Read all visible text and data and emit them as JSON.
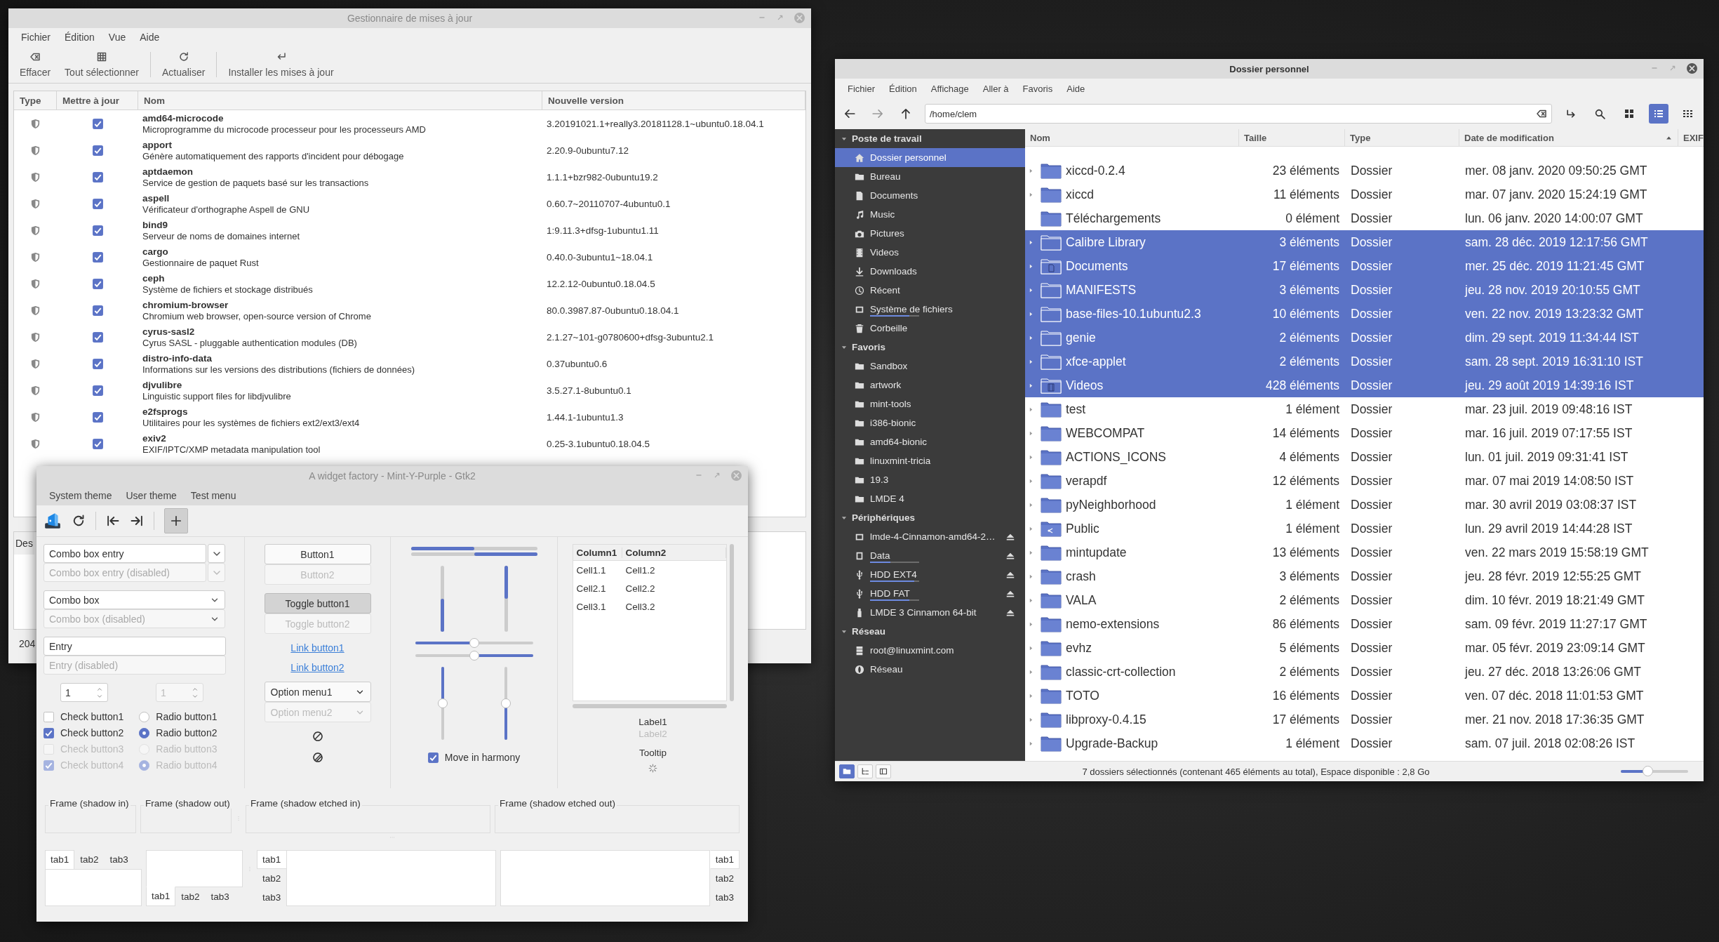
{
  "update_manager": {
    "title": "Gestionnaire de mises à jour",
    "menu": [
      "Fichier",
      "Édition",
      "Vue",
      "Aide"
    ],
    "toolbar": [
      [
        {
          "label": "Effacer",
          "kind": "clear"
        },
        {
          "label": "Tout sélectionner",
          "kind": "select"
        }
      ],
      [
        {
          "label": "Actualiser",
          "kind": "refresh"
        }
      ],
      [
        {
          "label": "Installer les mises à jour",
          "kind": "install"
        }
      ]
    ],
    "columns": [
      "Type",
      "Mettre à jour",
      "Nom",
      "Nouvelle version"
    ],
    "rows": [
      {
        "name": "amd64-microcode",
        "description": "Microprogramme du microcode processeur pour les processeurs AMD",
        "version": "3.20191021.1+really3.20181128.1~ubuntu0.18.04.1",
        "checked": true
      },
      {
        "name": "apport",
        "description": "Génère automatiquement des rapports d'incident pour débogage",
        "version": "2.20.9-0ubuntu7.12",
        "checked": true
      },
      {
        "name": "aptdaemon",
        "description": "Service de gestion de paquets basé sur les transactions",
        "version": "1.1.1+bzr982-0ubuntu19.2",
        "checked": true
      },
      {
        "name": "aspell",
        "description": "Vérificateur d'orthographe Aspell de GNU",
        "version": "0.60.7~20110707-4ubuntu0.1",
        "checked": true
      },
      {
        "name": "bind9",
        "description": "Serveur de noms de domaines internet",
        "version": "1:9.11.3+dfsg-1ubuntu1.11",
        "checked": true
      },
      {
        "name": "cargo",
        "description": "Gestionnaire de paquet Rust",
        "version": "0.40.0-3ubuntu1~18.04.1",
        "checked": true
      },
      {
        "name": "ceph",
        "description": "Système de fichiers et stockage distribués",
        "version": "12.2.12-0ubuntu0.18.04.5",
        "checked": true
      },
      {
        "name": "chromium-browser",
        "description": "Chromium web browser, open-source version of Chrome",
        "version": "80.0.3987.87-0ubuntu0.18.04.1",
        "checked": true
      },
      {
        "name": "cyrus-sasl2",
        "description": "Cyrus SASL - pluggable authentication modules (DB)",
        "version": "2.1.27~101-g0780600+dfsg-3ubuntu2.1",
        "checked": true
      },
      {
        "name": "distro-info-data",
        "description": "Informations sur les versions des distributions (fichiers de données)",
        "version": "0.37ubuntu0.6",
        "checked": true
      },
      {
        "name": "djvulibre",
        "description": "Linguistic support files for libdjvulibre",
        "version": "3.5.27.1-8ubuntu0.1",
        "checked": true
      },
      {
        "name": "e2fsprogs",
        "description": "Utilitaires pour les systèmes de fichiers ext2/ext3/ext4",
        "version": "1.44.1-1ubuntu1.3",
        "checked": true
      },
      {
        "name": "exiv2",
        "description": "EXIF/IPTC/XMP metadata manipulation tool",
        "version": "0.25-3.1ubuntu0.18.04.5",
        "checked": true
      }
    ],
    "details_tab": "Des",
    "status": "204"
  },
  "widget_factory": {
    "title": "A widget factory - Mint-Y-Purple - Gtk2",
    "menu": [
      "System theme",
      "User theme",
      "Test menu"
    ],
    "toolbar": [
      [
        {
          "kind": "app"
        },
        {
          "kind": "refresh"
        }
      ],
      [
        {
          "kind": "first"
        },
        {
          "kind": "last"
        }
      ],
      [
        {
          "kind": "add",
          "on": true
        }
      ]
    ],
    "combo_entries": [
      {
        "value": "Combo box entry",
        "disabled": false
      },
      {
        "value": "Combo box entry (disabled)",
        "disabled": true
      }
    ],
    "combos": [
      {
        "value": "Combo box",
        "disabled": false
      },
      {
        "value": "Combo box (disabled)",
        "disabled": true
      }
    ],
    "entries": [
      {
        "value": "Entry",
        "disabled": false
      },
      {
        "value": "Entry (disabled)",
        "disabled": true
      }
    ],
    "spins": [
      {
        "value": "1",
        "disabled": false
      },
      {
        "value": "1",
        "disabled": true
      }
    ],
    "checks": [
      {
        "label": "Check button1",
        "checked": false,
        "disabled": false
      },
      {
        "label": "Check button2",
        "checked": true,
        "disabled": false
      },
      {
        "label": "Check button3",
        "checked": false,
        "disabled": true
      },
      {
        "label": "Check button4",
        "checked": true,
        "disabled": true
      }
    ],
    "radios": [
      {
        "label": "Radio button1",
        "selected": false,
        "disabled": false
      },
      {
        "label": "Radio button2",
        "selected": true,
        "disabled": false
      },
      {
        "label": "Radio button3",
        "selected": false,
        "disabled": true
      },
      {
        "label": "Radio button4",
        "selected": true,
        "disabled": true
      }
    ],
    "buttons": [
      {
        "label": "Button1",
        "disabled": false
      },
      {
        "label": "Button2",
        "disabled": true
      }
    ],
    "toggles": [
      {
        "label": "Toggle button1",
        "on": true,
        "disabled": false
      },
      {
        "label": "Toggle button2",
        "on": false,
        "disabled": true
      }
    ],
    "links": [
      "Link button1",
      "Link button2"
    ],
    "option_menus": [
      {
        "value": "Option menu1",
        "disabled": false
      },
      {
        "value": "Option menu2",
        "disabled": true
      }
    ],
    "progress_bars": [
      {
        "level": 0.5,
        "inverted": false
      },
      {
        "level": 0.5,
        "inverted": true
      }
    ],
    "vertical_progress": [
      {
        "level": 0.5,
        "inverted": false
      },
      {
        "level": 0.5,
        "inverted": true
      }
    ],
    "hscales": [
      {
        "level": 0.5,
        "inverted": false
      },
      {
        "level": 0.5,
        "inverted": true
      }
    ],
    "vscales": [
      {
        "level": 0.5,
        "inverted": false
      },
      {
        "level": 0.5,
        "inverted": true
      }
    ],
    "harmony": {
      "label": "Move in harmony",
      "checked": true
    },
    "tree": {
      "columns": [
        "Column1",
        "Column2"
      ],
      "rows": [
        [
          "Cell1.1",
          "Cell1.2"
        ],
        [
          "Cell2.1",
          "Cell2.2"
        ],
        [
          "Cell3.1",
          "Cell3.2"
        ]
      ]
    },
    "labels": [
      {
        "text": "Label1",
        "disabled": false
      },
      {
        "text": "Label2",
        "disabled": true
      }
    ],
    "tooltip": "Tooltip",
    "frames": [
      "Frame (shadow in)",
      "Frame (shadow out)",
      "Frame (shadow etched in)",
      "Frame (shadow etched out)"
    ],
    "notebooks": [
      {
        "kind": "top",
        "tabs": [
          {
            "label": "tab1",
            "selected": true
          },
          {
            "label": "tab2",
            "selected": false
          },
          {
            "label": "tab3",
            "selected": false
          }
        ]
      },
      {
        "kind": "bottom",
        "tabs": [
          {
            "label": "tab1",
            "selected": true
          },
          {
            "label": "tab2",
            "selected": false
          },
          {
            "label": "tab3",
            "selected": false
          }
        ]
      },
      {
        "kind": "left",
        "tabs": [
          {
            "label": "tab1",
            "selected": true
          },
          {
            "label": "tab2",
            "selected": false
          },
          {
            "label": "tab3",
            "selected": false
          }
        ]
      },
      {
        "kind": "right",
        "tabs": [
          {
            "label": "tab1",
            "selected": true
          },
          {
            "label": "tab2",
            "selected": false
          },
          {
            "label": "tab3",
            "selected": false
          }
        ]
      }
    ]
  },
  "file_manager": {
    "title": "Dossier personnel",
    "menu": [
      "Fichier",
      "Édition",
      "Affichage",
      "Aller à",
      "Favoris",
      "Aide"
    ],
    "path": "/home/clem",
    "tools": [
      {
        "kind": "location"
      },
      {
        "kind": "search"
      },
      {
        "kind": "icons",
        "selected": false
      },
      {
        "kind": "list",
        "selected": true
      },
      {
        "kind": "compact",
        "selected": false
      }
    ],
    "sidebar": [
      {
        "heading": "Poste de travail",
        "expanded": true,
        "items": [
          {
            "label": "Dossier personnel",
            "kind": "home",
            "selected": true
          },
          {
            "label": "Bureau",
            "kind": "folder",
            "selected": false
          },
          {
            "label": "Documents",
            "kind": "doc",
            "selected": false
          },
          {
            "label": "Music",
            "kind": "music",
            "selected": false
          },
          {
            "label": "Pictures",
            "kind": "camera",
            "selected": false
          },
          {
            "label": "Videos",
            "kind": "film",
            "selected": false
          },
          {
            "label": "Downloads",
            "kind": "download",
            "selected": false
          },
          {
            "label": "Récent",
            "kind": "clock",
            "selected": false
          },
          {
            "label": "Système de fichiers",
            "kind": "drive",
            "selected": false,
            "level": 0.8
          },
          {
            "label": "Corbeille",
            "kind": "trash",
            "selected": false
          }
        ]
      },
      {
        "heading": "Favoris",
        "expanded": true,
        "items": [
          {
            "label": "Sandbox",
            "kind": "folder",
            "selected": false
          },
          {
            "label": "artwork",
            "kind": "folder",
            "selected": false
          },
          {
            "label": "mint-tools",
            "kind": "folder",
            "selected": false
          },
          {
            "label": "i386-bionic",
            "kind": "folder",
            "selected": false
          },
          {
            "label": "amd64-bionic",
            "kind": "folder",
            "selected": false
          },
          {
            "label": "linuxmint-tricia",
            "kind": "folder",
            "selected": false
          },
          {
            "label": "19.3",
            "kind": "folder",
            "selected": false
          },
          {
            "label": "LMDE 4",
            "kind": "folder",
            "selected": false
          }
        ]
      },
      {
        "heading": "Périphériques",
        "expanded": true,
        "items": [
          {
            "label": "lmde-4-Cinnamon-amd64-2…",
            "kind": "drive",
            "selected": false,
            "eject": true
          },
          {
            "label": "Data",
            "kind": "chip",
            "selected": false,
            "eject": true,
            "level": 0.42
          },
          {
            "label": "HDD EXT4",
            "kind": "usb",
            "selected": false,
            "eject": true,
            "level": 0.9
          },
          {
            "label": "HDD FAT",
            "kind": "usb",
            "selected": false,
            "eject": true,
            "level": 0.8
          },
          {
            "label": "LMDE 3 Cinnamon 64-bit",
            "kind": "stick",
            "selected": false,
            "eject": true
          }
        ]
      },
      {
        "heading": "Réseau",
        "expanded": true,
        "items": [
          {
            "label": "root@linuxmint.com",
            "kind": "server",
            "selected": false
          },
          {
            "label": "Réseau",
            "kind": "globe",
            "selected": false
          }
        ]
      }
    ],
    "columns": [
      {
        "label": "Nom",
        "sorted": false
      },
      {
        "label": "Taille",
        "sorted": false
      },
      {
        "label": "Type",
        "sorted": false
      },
      {
        "label": "Date de modification",
        "sorted": true
      },
      {
        "label": "EXIF",
        "sorted": false
      }
    ],
    "rows": [
      {
        "name": "xiccd-0.2.4",
        "size": "23 éléments",
        "type": "Dossier",
        "date": "mer. 08 janv. 2020 09:50:25 GMT",
        "selected": false,
        "kind": "folder",
        "expander": true
      },
      {
        "name": "xiccd",
        "size": "11 éléments",
        "type": "Dossier",
        "date": "mar. 07 janv. 2020 15:24:19 GMT",
        "selected": false,
        "kind": "folder",
        "expander": true
      },
      {
        "name": "Téléchargements",
        "size": "0 élément",
        "type": "Dossier",
        "date": "lun. 06 janv. 2020 14:00:07 GMT",
        "selected": false,
        "kind": "folder",
        "expander": false
      },
      {
        "name": "Calibre Library",
        "size": "3 éléments",
        "type": "Dossier",
        "date": "sam. 28 déc. 2019 12:17:56 GMT",
        "selected": true,
        "kind": "folder",
        "expander": true
      },
      {
        "name": "Documents",
        "size": "17 éléments",
        "type": "Dossier",
        "date": "mer. 25 déc. 2019 11:21:45 GMT",
        "selected": true,
        "kind": "documents",
        "expander": true
      },
      {
        "name": "MANIFESTS",
        "size": "3 éléments",
        "type": "Dossier",
        "date": "jeu. 28 nov. 2019 20:10:55 GMT",
        "selected": true,
        "kind": "folder",
        "expander": true
      },
      {
        "name": "base-files-10.1ubuntu2.3",
        "size": "10 éléments",
        "type": "Dossier",
        "date": "ven. 22 nov. 2019 13:23:32 GMT",
        "selected": true,
        "kind": "folder",
        "expander": true
      },
      {
        "name": "genie",
        "size": "2 éléments",
        "type": "Dossier",
        "date": "dim. 29 sept. 2019 11:34:44 IST",
        "selected": true,
        "kind": "folder",
        "expander": true
      },
      {
        "name": "xfce-applet",
        "size": "2 éléments",
        "type": "Dossier",
        "date": "sam. 28 sept. 2019 16:31:10 IST",
        "selected": true,
        "kind": "folder",
        "expander": true
      },
      {
        "name": "Videos",
        "size": "428 éléments",
        "type": "Dossier",
        "date": "jeu. 29 août 2019 14:39:16 IST",
        "selected": true,
        "kind": "videos",
        "expander": true
      },
      {
        "name": "test",
        "size": "1 élément",
        "type": "Dossier",
        "date": "mar. 23 juil. 2019 09:48:16 IST",
        "selected": false,
        "kind": "folder",
        "expander": true
      },
      {
        "name": "WEBCOMPAT",
        "size": "14 éléments",
        "type": "Dossier",
        "date": "mar. 16 juil. 2019 07:17:55 IST",
        "selected": false,
        "kind": "folder",
        "expander": true
      },
      {
        "name": "ACTIONS_ICONS",
        "size": "4 éléments",
        "type": "Dossier",
        "date": "lun. 01 juil. 2019 09:31:41 IST",
        "selected": false,
        "kind": "folder",
        "expander": true
      },
      {
        "name": "verapdf",
        "size": "12 éléments",
        "type": "Dossier",
        "date": "mar. 07 mai 2019 14:08:50 IST",
        "selected": false,
        "kind": "folder",
        "expander": true
      },
      {
        "name": "pyNeighborhood",
        "size": "1 élément",
        "type": "Dossier",
        "date": "mar. 30 avril 2019 03:08:37 IST",
        "selected": false,
        "kind": "folder",
        "expander": true
      },
      {
        "name": "Public",
        "size": "1 élément",
        "type": "Dossier",
        "date": "lun. 29 avril 2019 14:44:28 IST",
        "selected": false,
        "kind": "public",
        "expander": true
      },
      {
        "name": "mintupdate",
        "size": "13 éléments",
        "type": "Dossier",
        "date": "ven. 22 mars 2019 15:58:19 GMT",
        "selected": false,
        "kind": "folder",
        "expander": true
      },
      {
        "name": "crash",
        "size": "3 éléments",
        "type": "Dossier",
        "date": "jeu. 28 févr. 2019 12:55:25 GMT",
        "selected": false,
        "kind": "folder",
        "expander": true
      },
      {
        "name": "VALA",
        "size": "2 éléments",
        "type": "Dossier",
        "date": "dim. 10 févr. 2019 18:21:49 GMT",
        "selected": false,
        "kind": "folder",
        "expander": true
      },
      {
        "name": "nemo-extensions",
        "size": "86 éléments",
        "type": "Dossier",
        "date": "sam. 09 févr. 2019 11:27:17 GMT",
        "selected": false,
        "kind": "folder",
        "expander": true
      },
      {
        "name": "evhz",
        "size": "5 éléments",
        "type": "Dossier",
        "date": "mar. 05 févr. 2019 23:09:14 GMT",
        "selected": false,
        "kind": "folder",
        "expander": true
      },
      {
        "name": "classic-crt-collection",
        "size": "2 éléments",
        "type": "Dossier",
        "date": "jeu. 27 déc. 2018 13:26:06 GMT",
        "selected": false,
        "kind": "folder",
        "expander": true
      },
      {
        "name": "TOTO",
        "size": "16 éléments",
        "type": "Dossier",
        "date": "ven. 07 déc. 2018 11:01:53 GMT",
        "selected": false,
        "kind": "folder",
        "expander": true
      },
      {
        "name": "libproxy-0.4.15",
        "size": "17 éléments",
        "type": "Dossier",
        "date": "mer. 21 nov. 2018 17:36:35 GMT",
        "selected": false,
        "kind": "folder",
        "expander": true
      },
      {
        "name": "Upgrade-Backup",
        "size": "1 élément",
        "type": "Dossier",
        "date": "sam. 07 juil. 2018 02:08:26 IST",
        "selected": false,
        "kind": "folder",
        "expander": true
      }
    ],
    "bottom_buttons": [
      {
        "kind": "places",
        "selected": true
      },
      {
        "kind": "tree",
        "selected": false
      },
      {
        "kind": "sidebar",
        "selected": false
      }
    ],
    "status": "7 dossiers sélectionnés (contenant 465 éléments au total), Espace disponible : 2,8 Go",
    "zoom": {
      "level": 0.4
    }
  }
}
